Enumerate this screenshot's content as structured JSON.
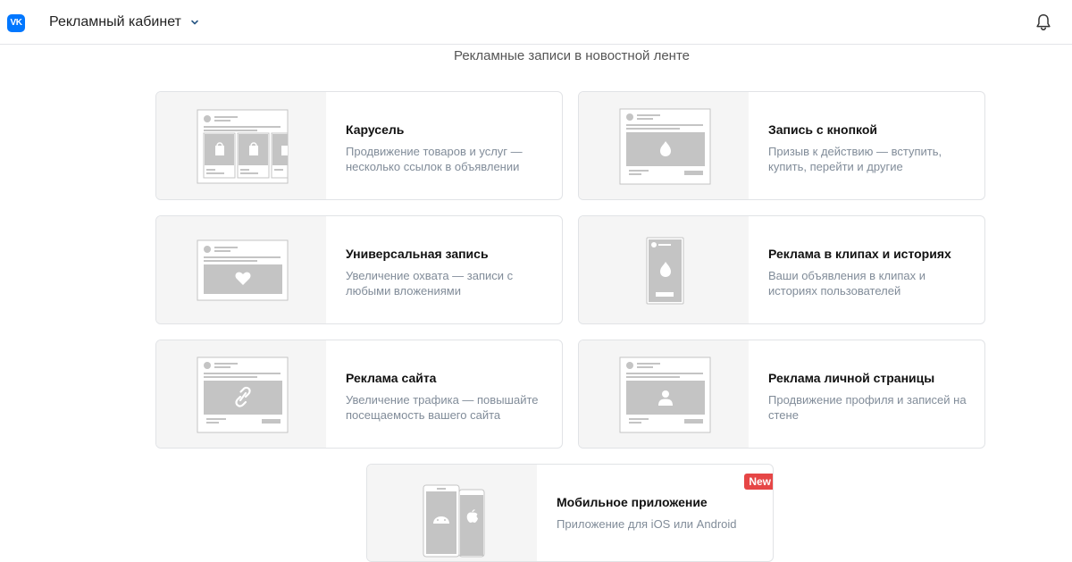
{
  "header": {
    "logo_text": "VK",
    "title": "Рекламный кабинет",
    "icons": [
      "vk-logo",
      "chevron-down-icon",
      "bell-icon"
    ]
  },
  "section": {
    "title": "Рекламные записи в новостной ленте"
  },
  "cards": [
    {
      "title": "Карусель",
      "description": "Продвижение товаров и услуг — несколько ссылок в объявлении",
      "icon": "carousel-preview"
    },
    {
      "title": "Запись с кнопкой",
      "description": "Призыв к действию — вступить, купить, перейти и другие",
      "icon": "button-post-preview"
    },
    {
      "title": "Универсальная запись",
      "description": "Увеличение охвата — записи с любыми вложениями",
      "icon": "universal-post-preview"
    },
    {
      "title": "Реклама в клипах и историях",
      "description": "Ваши объявления в клипах и историях пользователей",
      "icon": "clips-stories-preview"
    },
    {
      "title": "Реклама сайта",
      "description": "Увеличение трафика — повышайте посещаемость вашего сайта",
      "icon": "website-ad-preview"
    },
    {
      "title": "Реклама личной страницы",
      "description": "Продвижение профиля и записей на стене",
      "icon": "personal-page-preview"
    },
    {
      "title": "Мобильное приложение",
      "description": "Приложение для iOS или Android",
      "icon": "mobile-app-preview",
      "badge": "New"
    }
  ],
  "colors": {
    "brand": "#0077ff",
    "badge": "#e64646",
    "placeholder": "#c4c4c4"
  }
}
